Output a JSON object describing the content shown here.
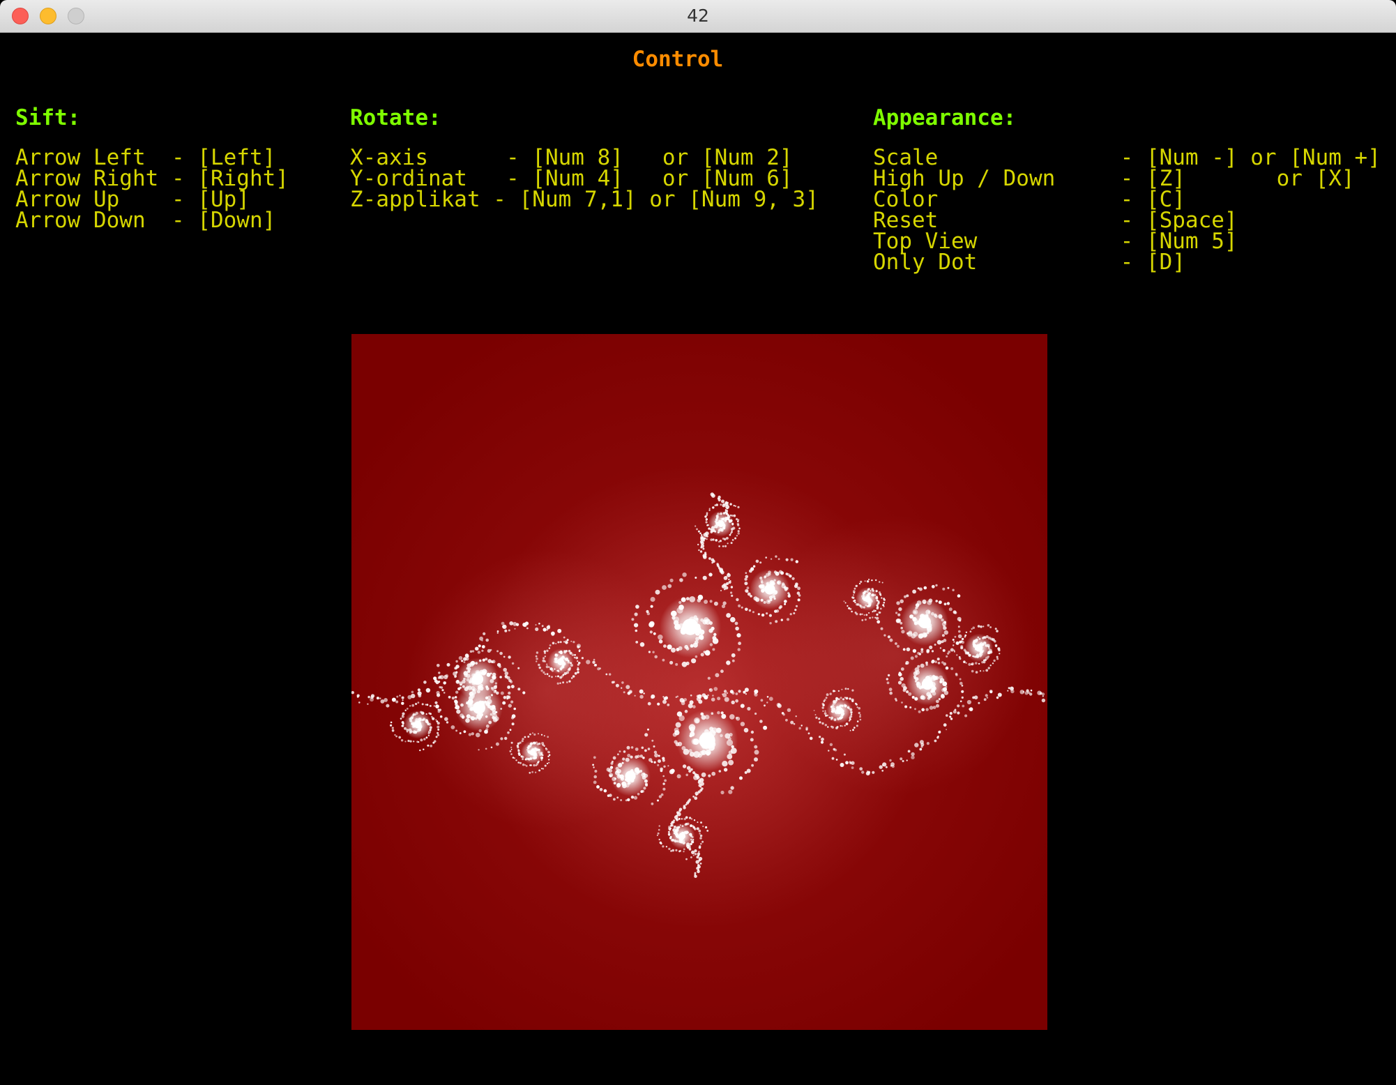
{
  "window": {
    "title": "42"
  },
  "heading": "Control",
  "sections": {
    "sift": {
      "title": "Sift:",
      "lines": [
        "Arrow Left  - [Left]",
        "Arrow Right - [Right]",
        "Arrow Up    - [Up]",
        "Arrow Down  - [Down]"
      ]
    },
    "rotate": {
      "title": "Rotate:",
      "lines": [
        "X-axis      - [Num 8]   or [Num 2]",
        "Y-ordinat   - [Num 4]   or [Num 6]",
        "Z-applikat - [Num 7,1] or [Num 9, 3]"
      ]
    },
    "appearance": {
      "title": "Appearance:",
      "lines": [
        "Scale              - [Num -] or [Num +]",
        "High Up / Down     - [Z]       or [X]",
        "Color              - [C]",
        "Reset              - [Space]",
        "Top View           - [Num 5]",
        "Only Dot           - [D]"
      ]
    }
  },
  "colors": {
    "heading": "#ff8c00",
    "section_title": "#7fff00",
    "text": "#d6d600",
    "fractal_background": "#7a0000",
    "fractal_glow": "#ffffff"
  }
}
